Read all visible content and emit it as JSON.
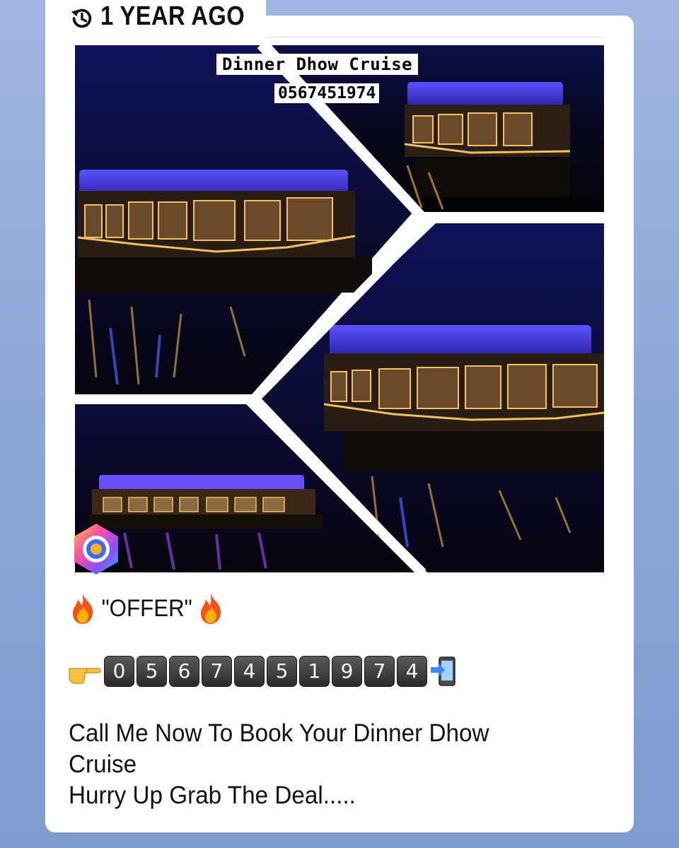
{
  "memory": {
    "label": "1 YEAR AGO",
    "icon": "history-clock-icon"
  },
  "post": {
    "image_overlay_title": "Dinner Dhow Cruise",
    "image_overlay_phone": "0567451974",
    "camera_icon": "camera-app-icon",
    "offer_text": "\"OFFER\"",
    "offer_icon": "fire-emoji-icon",
    "phone_lead_icon": "pointing-hand-emoji-icon",
    "phone_digits": [
      "0",
      "5",
      "6",
      "7",
      "4",
      "5",
      "1",
      "9",
      "7",
      "4"
    ],
    "phone_trail_icon": "mobile-phone-arrow-icon",
    "message_lines": [
      "Call Me Now To  Book Your Dinner Dhow",
      "Cruise",
      "Hurry Up Grab The Deal....."
    ]
  },
  "colors": {
    "background": "#8aa6d6",
    "card": "#ffffff",
    "night_sky": "#0a0a40",
    "boat_lights": "#6a6aff"
  }
}
